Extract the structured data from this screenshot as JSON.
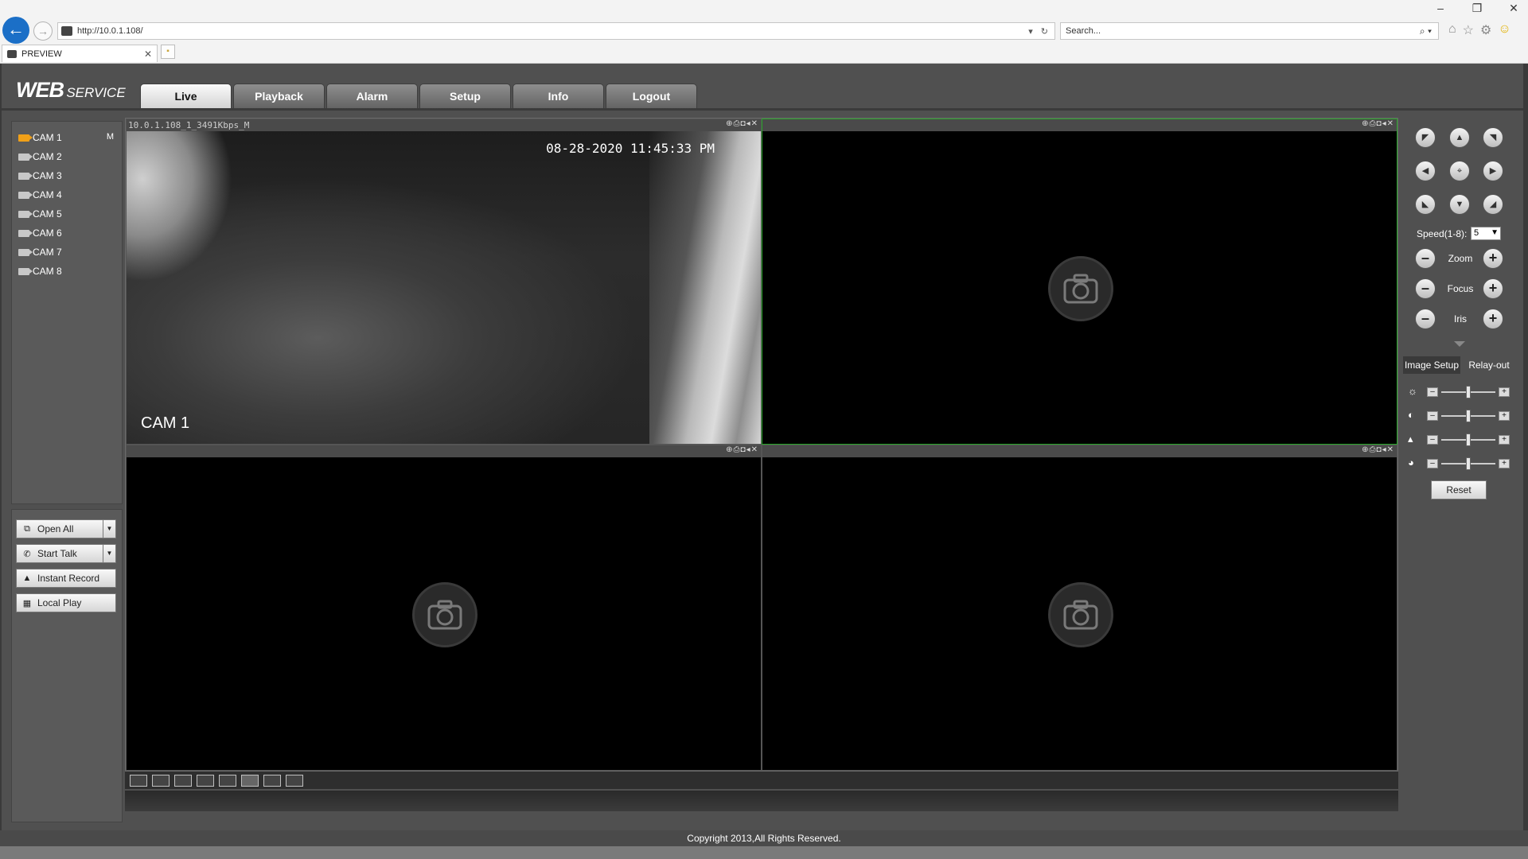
{
  "browser": {
    "url": "http://10.0.1.108/",
    "search_placeholder": "Search...",
    "tab_title": "PREVIEW",
    "window_controls": [
      "–",
      "❐",
      "✕"
    ]
  },
  "app": {
    "brand_main": "WEB",
    "brand_sub": "SERVICE",
    "menu": [
      {
        "label": "Live",
        "active": true
      },
      {
        "label": "Playback",
        "active": false
      },
      {
        "label": "Alarm",
        "active": false
      },
      {
        "label": "Setup",
        "active": false
      },
      {
        "label": "Info",
        "active": false
      },
      {
        "label": "Logout",
        "active": false
      }
    ]
  },
  "cameras": [
    {
      "label": "CAM 1",
      "active": true,
      "stream": "M"
    },
    {
      "label": "CAM 2",
      "active": false
    },
    {
      "label": "CAM 3",
      "active": false
    },
    {
      "label": "CAM 4",
      "active": false
    },
    {
      "label": "CAM 5",
      "active": false
    },
    {
      "label": "CAM 6",
      "active": false
    },
    {
      "label": "CAM 7",
      "active": false
    },
    {
      "label": "CAM 8",
      "active": false
    }
  ],
  "actions": [
    {
      "label": "Open All",
      "icon": "open-icon",
      "dropdown": true
    },
    {
      "label": "Start Talk",
      "icon": "phone-icon",
      "dropdown": true
    },
    {
      "label": "Instant Record",
      "icon": "warning-icon",
      "dropdown": false
    },
    {
      "label": "Local Play",
      "icon": "film-icon",
      "dropdown": false
    }
  ],
  "panes": [
    {
      "header": "10.0.1.108_1_3491Kbps_M",
      "timestamp": "08-28-2020 11:45:33 PM",
      "overlay_name": "CAM 1",
      "has_feed": true
    },
    {
      "header": "",
      "has_feed": false,
      "selected": true
    },
    {
      "header": "",
      "has_feed": false
    },
    {
      "header": "",
      "has_feed": false
    }
  ],
  "pane_tools": "⊕⎙◘◂✕",
  "ptz": {
    "speed_label": "Speed(1-8):",
    "speed_value": "5",
    "zoom_label": "Zoom",
    "focus_label": "Focus",
    "iris_label": "Iris"
  },
  "image_setup": {
    "tabs": [
      "Image Setup",
      "Relay-out"
    ],
    "sliders": [
      {
        "icon": "brightness-icon",
        "value": 0.5
      },
      {
        "icon": "contrast-icon",
        "value": 0.5
      },
      {
        "icon": "saturation-icon",
        "value": 0.5
      },
      {
        "icon": "hue-icon",
        "value": 0.5
      }
    ],
    "reset_label": "Reset"
  },
  "footer": "Copyright 2013,All Rights Reserved."
}
